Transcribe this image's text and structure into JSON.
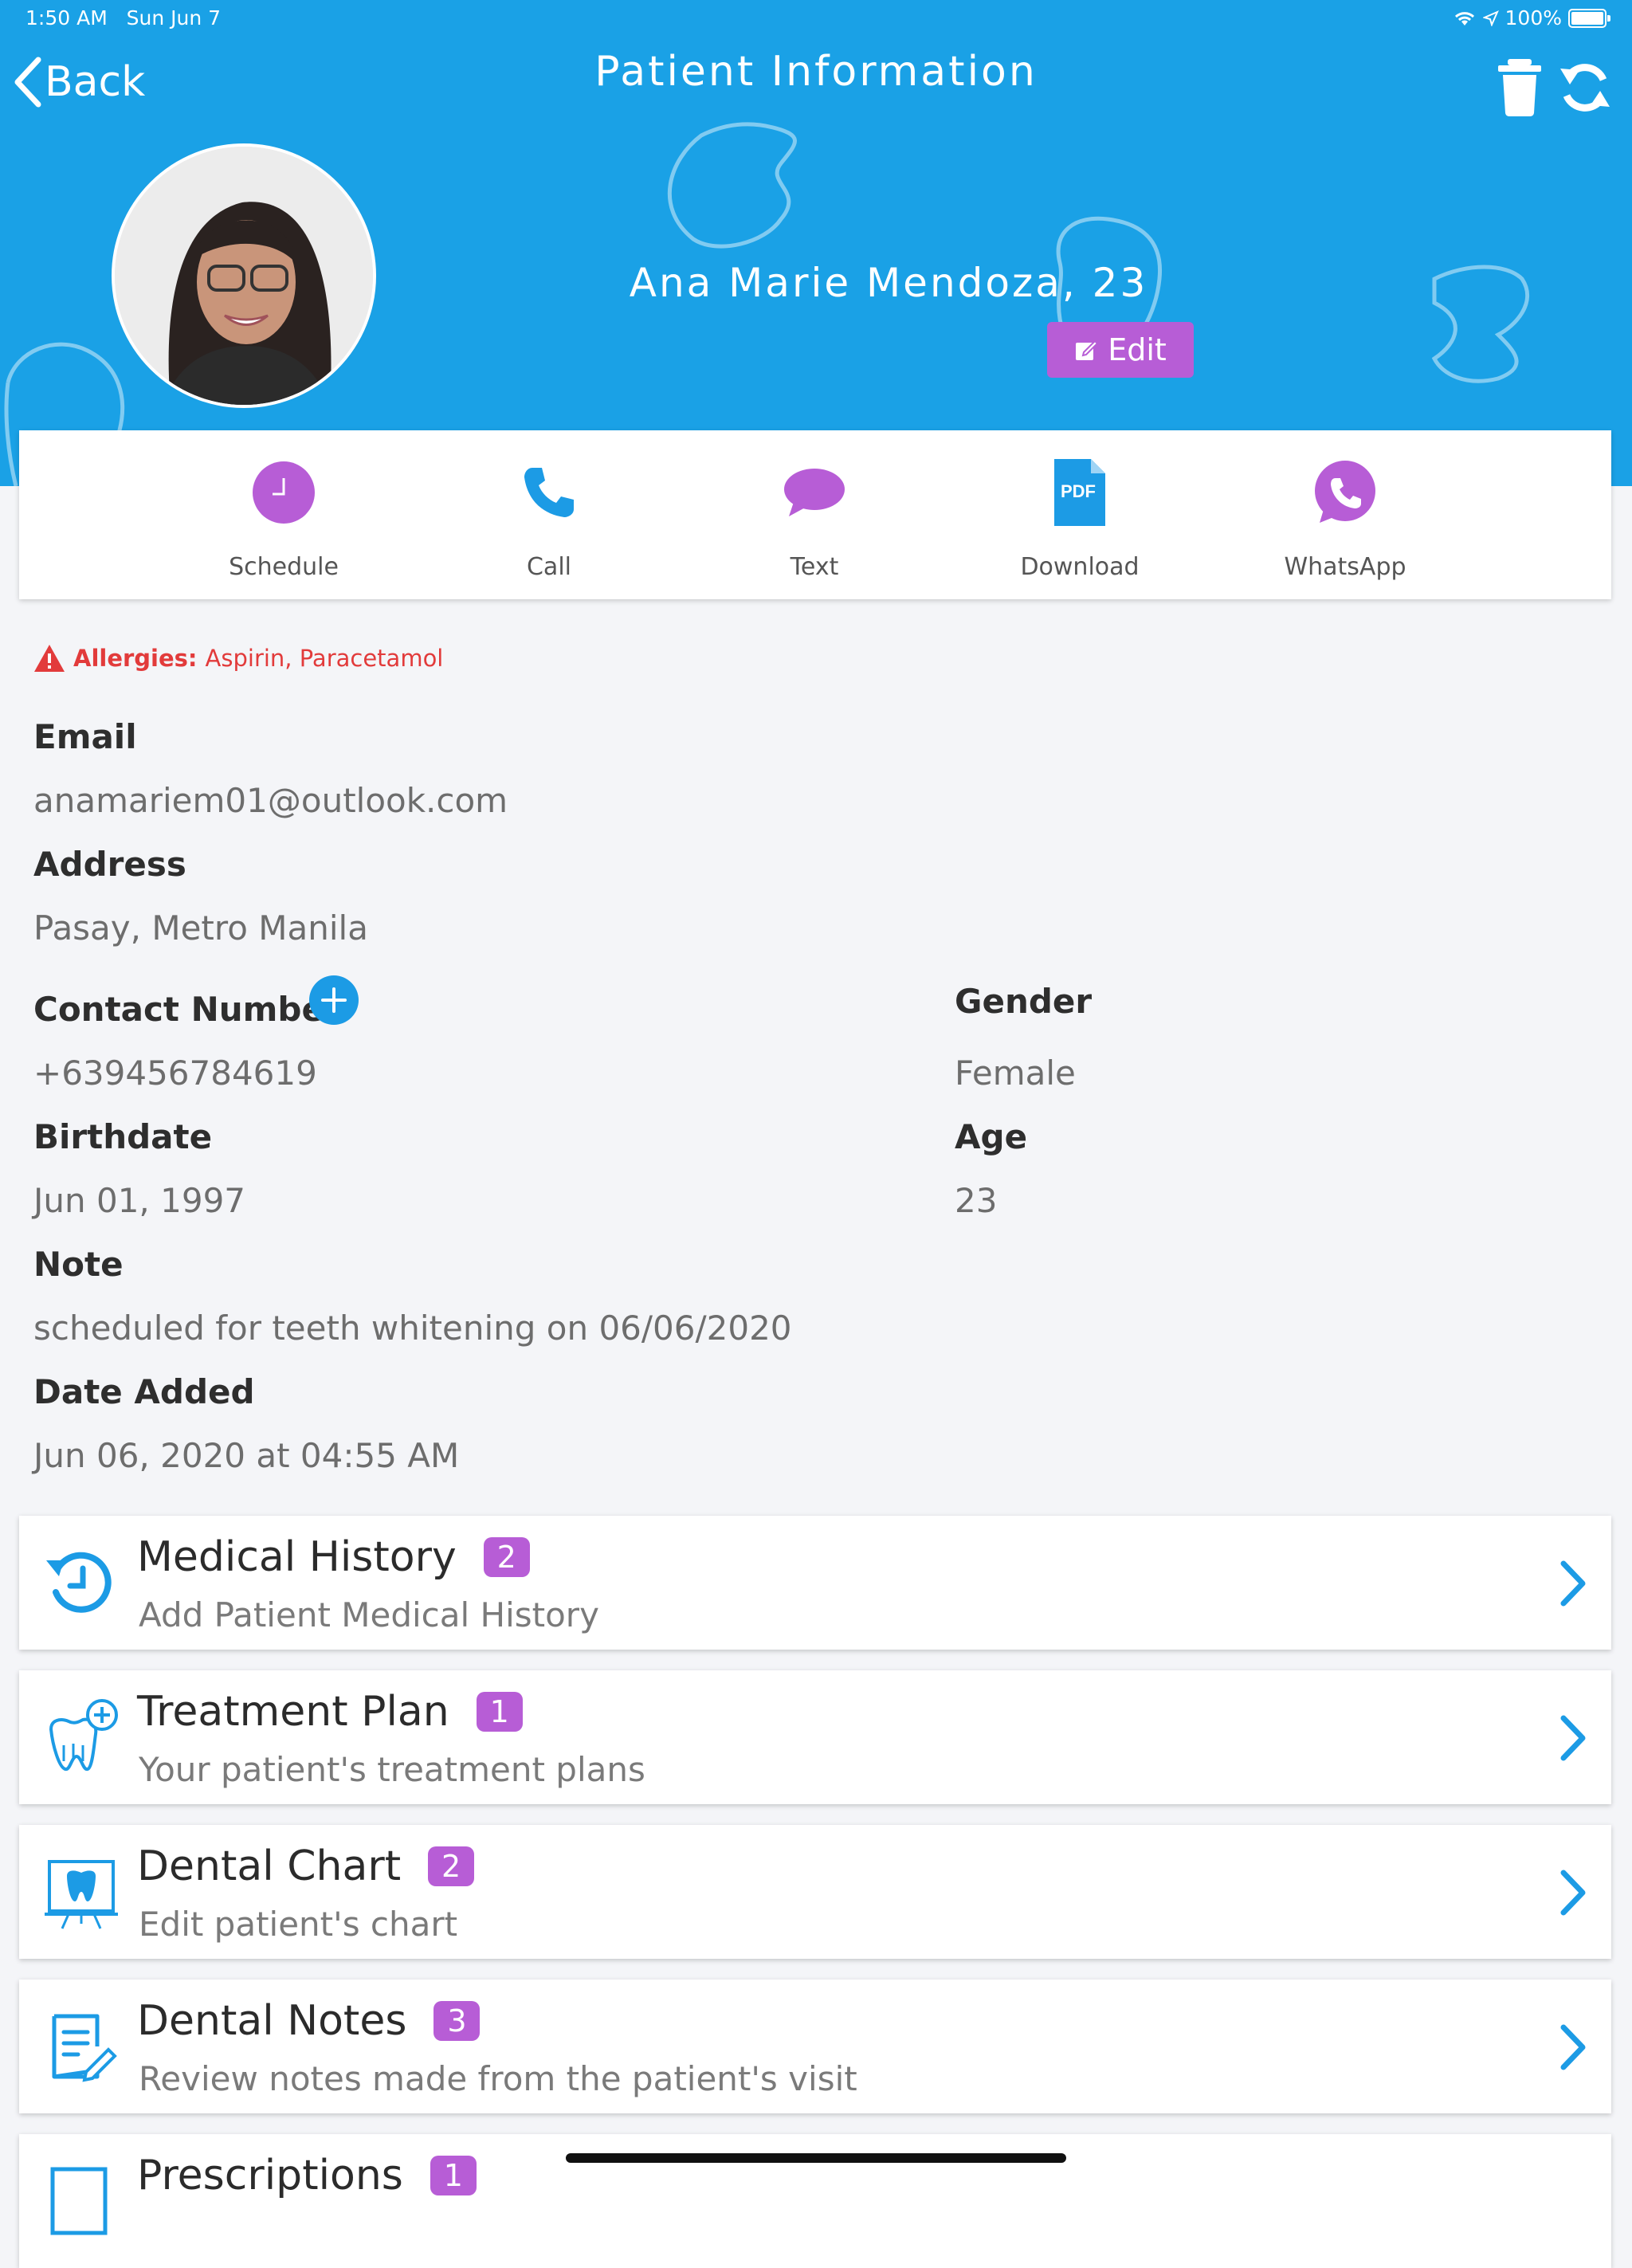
{
  "status_bar": {
    "time": "1:50 AM",
    "date": "Sun Jun 7",
    "battery": "100%"
  },
  "nav": {
    "back_label": "Back",
    "title": "Patient Information"
  },
  "patient": {
    "name_age": "Ana Marie Mendoza, 23",
    "edit_label": "Edit"
  },
  "actions": [
    {
      "label": "Schedule",
      "icon": "clock-icon"
    },
    {
      "label": "Call",
      "icon": "phone-icon"
    },
    {
      "label": "Text",
      "icon": "chat-bubble-icon"
    },
    {
      "label": "Download",
      "icon": "pdf-icon"
    },
    {
      "label": "WhatsApp",
      "icon": "whatsapp-icon"
    }
  ],
  "allergies": {
    "label": "Allergies:",
    "value": "Aspirin, Paracetamol"
  },
  "fields": {
    "email_label": "Email",
    "email": "anamariem01@outlook.com",
    "address_label": "Address",
    "address": "Pasay, Metro Manila",
    "contact_label": "Contact Number",
    "contact": "+639456784619",
    "gender_label": "Gender",
    "gender": "Female",
    "birthdate_label": "Birthdate",
    "birthdate": "Jun 01, 1997",
    "age_label": "Age",
    "age": "23",
    "note_label": "Note",
    "note": "scheduled for teeth whitening on 06/06/2020",
    "date_added_label": "Date Added",
    "date_added": "Jun 06, 2020 at 04:55 AM"
  },
  "cards": [
    {
      "title": "Medical History",
      "badge": "2",
      "subtitle": "Add Patient Medical History",
      "icon": "history-icon"
    },
    {
      "title": "Treatment Plan",
      "badge": "1",
      "subtitle": "Your patient's treatment plans",
      "icon": "tooth-plus-icon"
    },
    {
      "title": "Dental Chart",
      "badge": "2",
      "subtitle": "Edit patient's chart",
      "icon": "tooth-chart-icon"
    },
    {
      "title": "Dental Notes",
      "badge": "3",
      "subtitle": "Review notes made from the patient's visit",
      "icon": "notes-icon"
    },
    {
      "title": "Prescriptions",
      "badge": "1",
      "subtitle": "",
      "icon": "prescription-icon"
    }
  ],
  "colors": {
    "header": "#1aa1e6",
    "accent_purple": "#b75dd6",
    "link_blue": "#1c9be5",
    "alert_red": "#e23b3b"
  }
}
